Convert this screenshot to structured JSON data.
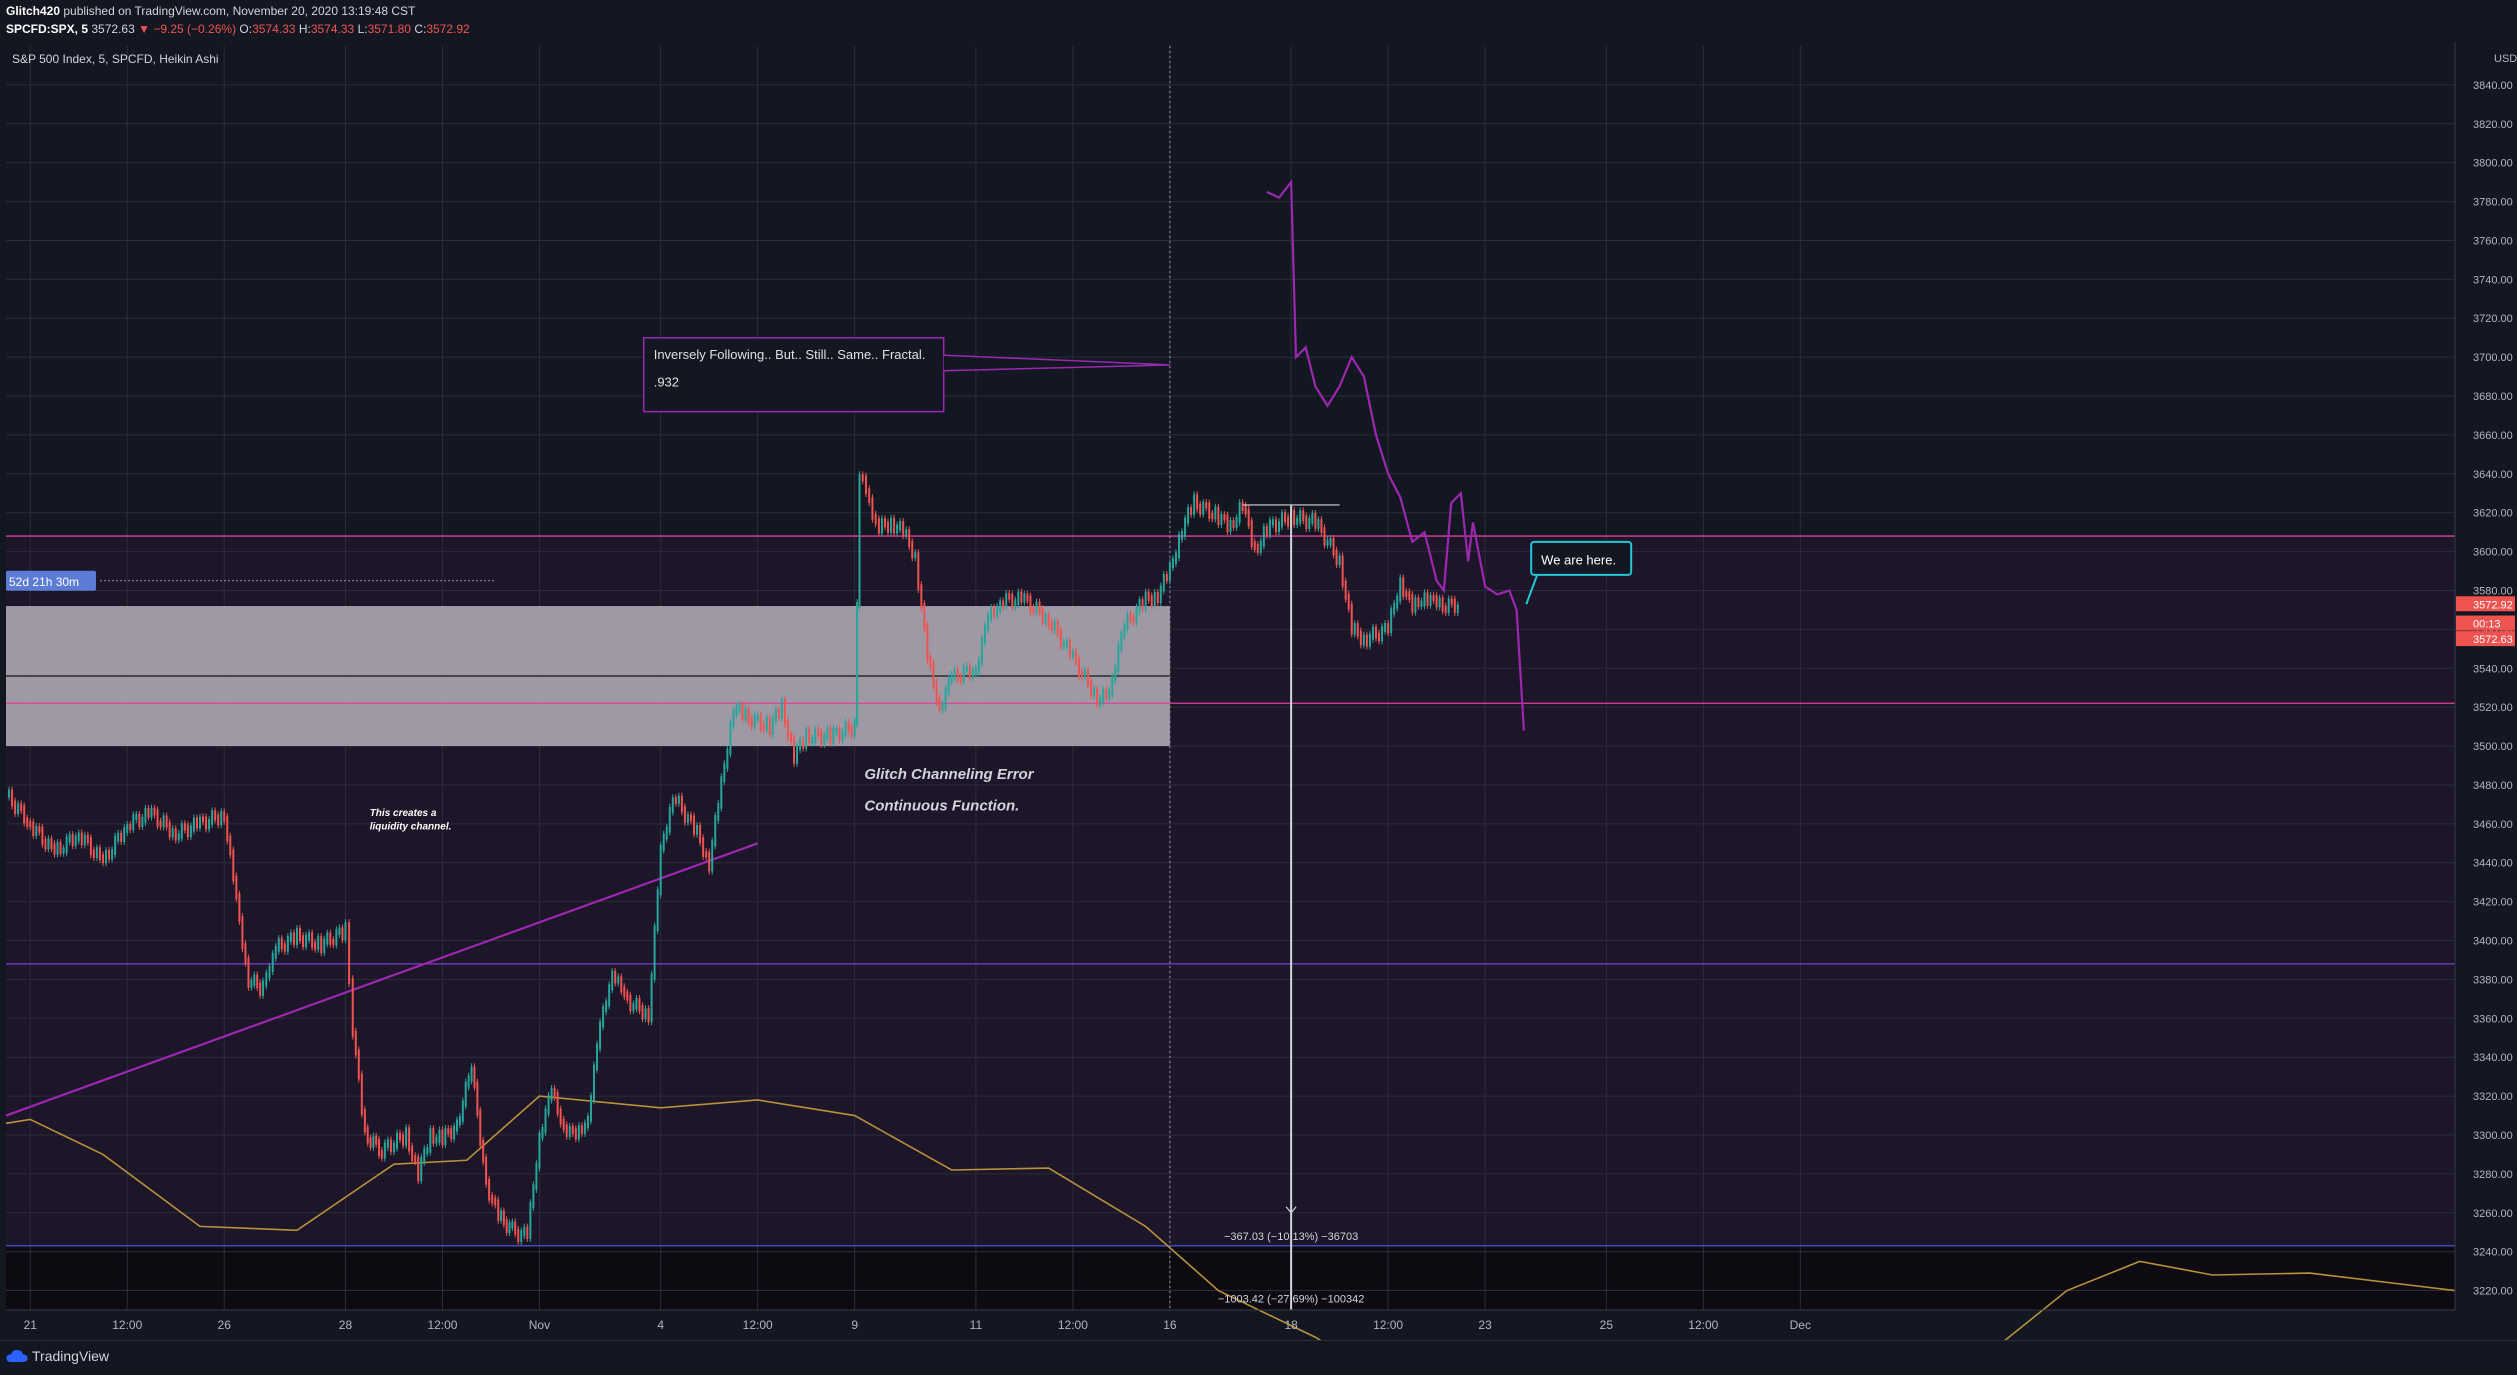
{
  "header": {
    "author": "Glitch420",
    "published_text": "published on TradingView.com, November 20, 2020 13:19:48 CST",
    "symbol": "SPCFD:SPX, 5",
    "last": "3572.63",
    "change": "−9.25 (−0.26%)",
    "o_label": "O:",
    "o": "3574.33",
    "h_label": "H:",
    "h": "3574.33",
    "l_label": "L:",
    "l": "3571.80",
    "c_label": "C:",
    "c": "3572.92"
  },
  "legend": "S&P 500 Index, 5, SPCFD, Heikin Ashi",
  "footer": {
    "brand": "TradingView"
  },
  "colors": {
    "background": "#131722",
    "grid": "#2a2e39",
    "up": "#26a69a",
    "down": "#ef5350",
    "projection": "#9c27b0",
    "ma": "#b8913a",
    "zone": "#b6b0bb",
    "callout_border": "#9c27b0",
    "callout2_border": "#26c6da"
  },
  "chart_data": {
    "type": "line",
    "title": "S&P 500 Index, 5, SPCFD, Heikin Ashi",
    "ylim": [
      3210,
      3860
    ],
    "y_ticks": [
      3220,
      3240,
      3260,
      3280,
      3300,
      3320,
      3340,
      3360,
      3380,
      3400,
      3420,
      3440,
      3460,
      3480,
      3500,
      3520,
      3540,
      3560,
      3580,
      3600,
      3620,
      3640,
      3660,
      3680,
      3700,
      3720,
      3740,
      3760,
      3780,
      3800,
      3820,
      3840
    ],
    "y_tick_labels": [
      "3220.00",
      "3240.00",
      "3260.00",
      "3280.00",
      "3300.00",
      "3320.00",
      "3340.00",
      "3360.00",
      "3380.00",
      "3400.00",
      "3420.00",
      "3440.00",
      "3460.00",
      "3480.00",
      "3500.00",
      "3520.00",
      "3540.00",
      "3560.00",
      "3580.00",
      "3600.00",
      "3620.00",
      "3640.00",
      "3660.00",
      "3680.00",
      "3700.00",
      "3720.00",
      "3740.00",
      "3760.00",
      "3780.00",
      "3800.00",
      "3820.00",
      "3840.00"
    ],
    "y_unit": "USD",
    "x_ticks": [
      {
        "label": "21",
        "t": 1
      },
      {
        "label": "12:00",
        "t": 5
      },
      {
        "label": "26",
        "t": 9
      },
      {
        "label": "28",
        "t": 14
      },
      {
        "label": "12:00",
        "t": 18
      },
      {
        "label": "Nov",
        "t": 22
      },
      {
        "label": "4",
        "t": 27
      },
      {
        "label": "12:00",
        "t": 31
      },
      {
        "label": "9",
        "t": 35
      },
      {
        "label": "11",
        "t": 40
      },
      {
        "label": "12:00",
        "t": 44
      },
      {
        "label": "16",
        "t": 48
      },
      {
        "label": "18",
        "t": 53
      },
      {
        "label": "12:00",
        "t": 57
      },
      {
        "label": "23",
        "t": 61
      },
      {
        "label": "25",
        "t": 66
      },
      {
        "label": "12:00",
        "t": 70
      },
      {
        "label": "Dec",
        "t": 74
      }
    ],
    "xlim": [
      0,
      101
    ],
    "series": [
      {
        "role": "price",
        "points": [
          [
            0,
            3475
          ],
          [
            1,
            3460
          ],
          [
            2,
            3445
          ],
          [
            3,
            3455
          ],
          [
            4,
            3440
          ],
          [
            5,
            3460
          ],
          [
            6,
            3465
          ],
          [
            7,
            3455
          ],
          [
            8,
            3460
          ],
          [
            9,
            3465
          ],
          [
            9.5,
            3420
          ],
          [
            10,
            3380
          ],
          [
            10.6,
            3375
          ],
          [
            11,
            3395
          ],
          [
            12,
            3402
          ],
          [
            13,
            3398
          ],
          [
            14,
            3405
          ],
          [
            14.3,
            3355
          ],
          [
            14.8,
            3300
          ],
          [
            15.5,
            3292
          ],
          [
            16.5,
            3300
          ],
          [
            17,
            3280
          ],
          [
            17.5,
            3300
          ],
          [
            18,
            3298
          ],
          [
            18.6,
            3305
          ],
          [
            19.2,
            3335
          ],
          [
            19.8,
            3275
          ],
          [
            20.3,
            3258
          ],
          [
            21,
            3250
          ],
          [
            21.5,
            3248
          ],
          [
            22,
            3300
          ],
          [
            22.5,
            3322
          ],
          [
            23,
            3305
          ],
          [
            23.5,
            3298
          ],
          [
            24,
            3310
          ],
          [
            24.5,
            3355
          ],
          [
            25,
            3385
          ],
          [
            25.5,
            3370
          ],
          [
            26.5,
            3362
          ],
          [
            27,
            3445
          ],
          [
            27.5,
            3475
          ],
          [
            28.5,
            3455
          ],
          [
            29,
            3440
          ],
          [
            29.5,
            3480
          ],
          [
            30,
            3520
          ],
          [
            30.5,
            3515
          ],
          [
            31.5,
            3510
          ],
          [
            32,
            3520
          ],
          [
            32.5,
            3495
          ],
          [
            33,
            3505
          ],
          [
            34,
            3505
          ],
          [
            35,
            3510
          ],
          [
            35.2,
            3640
          ],
          [
            35.6,
            3625
          ],
          [
            36,
            3612
          ],
          [
            36.5,
            3615
          ],
          [
            37,
            3610
          ],
          [
            37.5,
            3598
          ],
          [
            38,
            3545
          ],
          [
            38.5,
            3520
          ],
          [
            39,
            3535
          ],
          [
            40,
            3540
          ],
          [
            40.5,
            3565
          ],
          [
            41,
            3575
          ],
          [
            42,
            3575
          ],
          [
            43,
            3565
          ],
          [
            44,
            3545
          ],
          [
            45,
            3525
          ],
          [
            45.5,
            3525
          ],
          [
            46,
            3560
          ],
          [
            47,
            3575
          ],
          [
            47.5,
            3578
          ],
          [
            48,
            3590
          ],
          [
            48.5,
            3612
          ],
          [
            49,
            3625
          ],
          [
            50,
            3618
          ],
          [
            50.5,
            3612
          ],
          [
            51,
            3625
          ],
          [
            51.5,
            3600
          ],
          [
            52,
            3612
          ],
          [
            53,
            3618
          ],
          [
            54,
            3615
          ],
          [
            55,
            3595
          ],
          [
            55.5,
            3560
          ],
          [
            56,
            3555
          ],
          [
            57,
            3560
          ],
          [
            57.5,
            3585
          ],
          [
            58,
            3570
          ],
          [
            58.5,
            3578
          ],
          [
            59,
            3572
          ],
          [
            60,
            3572.63
          ]
        ]
      },
      {
        "role": "projection",
        "points": [
          [
            52,
            3785
          ],
          [
            52.5,
            3782
          ],
          [
            53,
            3790
          ],
          [
            53.2,
            3700
          ],
          [
            53.6,
            3705
          ],
          [
            54,
            3685
          ],
          [
            54.5,
            3675
          ],
          [
            55,
            3685
          ],
          [
            55.5,
            3700
          ],
          [
            56,
            3690
          ],
          [
            56.5,
            3660
          ],
          [
            57,
            3640
          ],
          [
            57.5,
            3628
          ],
          [
            58,
            3605
          ],
          [
            58.5,
            3610
          ],
          [
            59,
            3585
          ],
          [
            59.3,
            3580
          ],
          [
            59.6,
            3625
          ],
          [
            60,
            3630
          ],
          [
            60.3,
            3595
          ],
          [
            60.5,
            3615
          ],
          [
            61,
            3582
          ],
          [
            61.5,
            3578
          ],
          [
            62,
            3580
          ],
          [
            62.3,
            3570
          ],
          [
            62.6,
            3508
          ]
        ]
      },
      {
        "role": "moving_average",
        "points": [
          [
            0,
            3306
          ],
          [
            1,
            3308
          ],
          [
            4,
            3290
          ],
          [
            8,
            3253
          ],
          [
            12,
            3251
          ],
          [
            16,
            3285
          ],
          [
            19,
            3287
          ],
          [
            22,
            3320
          ],
          [
            27,
            3314
          ],
          [
            31,
            3318
          ],
          [
            35,
            3310
          ],
          [
            39,
            3282
          ],
          [
            43,
            3283
          ],
          [
            47,
            3253
          ],
          [
            50,
            3220
          ],
          [
            54,
            3196
          ],
          [
            60,
            3150
          ],
          [
            70,
            3155
          ],
          [
            80,
            3170
          ],
          [
            85,
            3220
          ],
          [
            88,
            3235
          ],
          [
            91,
            3228
          ],
          [
            95,
            3229
          ],
          [
            101,
            3220
          ]
        ]
      }
    ],
    "horizontal_levels": [
      {
        "value": 3608,
        "color": "#e0409a"
      },
      {
        "value": 3522,
        "color": "#e0409a"
      },
      {
        "value": 3388,
        "color": "#7b3fd0"
      },
      {
        "value": 3243,
        "color": "#4353c8"
      }
    ],
    "zone": {
      "from": 3500,
      "to": 3572,
      "t_start": 0,
      "t_end": 48
    },
    "labels": [
      {
        "text": "52d 21h 30m"
      },
      {
        "text": "Inversely Following.. But.. Still.. Same.. Fractal."
      },
      {
        "text": ".932"
      },
      {
        "text": "We are here."
      },
      {
        "text": "Glitch Channeling Error"
      },
      {
        "text": "Continuous Function."
      },
      {
        "text": "This creates a"
      },
      {
        "text": "liquidity channel."
      },
      {
        "text": "−367.03 (−10.13%) −36703"
      },
      {
        "text": "−1003.42 (−27.69%) −100342"
      }
    ],
    "price_tags": [
      {
        "text": "3572.92",
        "value": 3572.92,
        "color": "#ef5350"
      },
      {
        "text": "00:13",
        "value": 3563,
        "color": "#ef5350"
      },
      {
        "text": "3572.63",
        "value": 3555,
        "color": "#ef5350"
      }
    ]
  }
}
